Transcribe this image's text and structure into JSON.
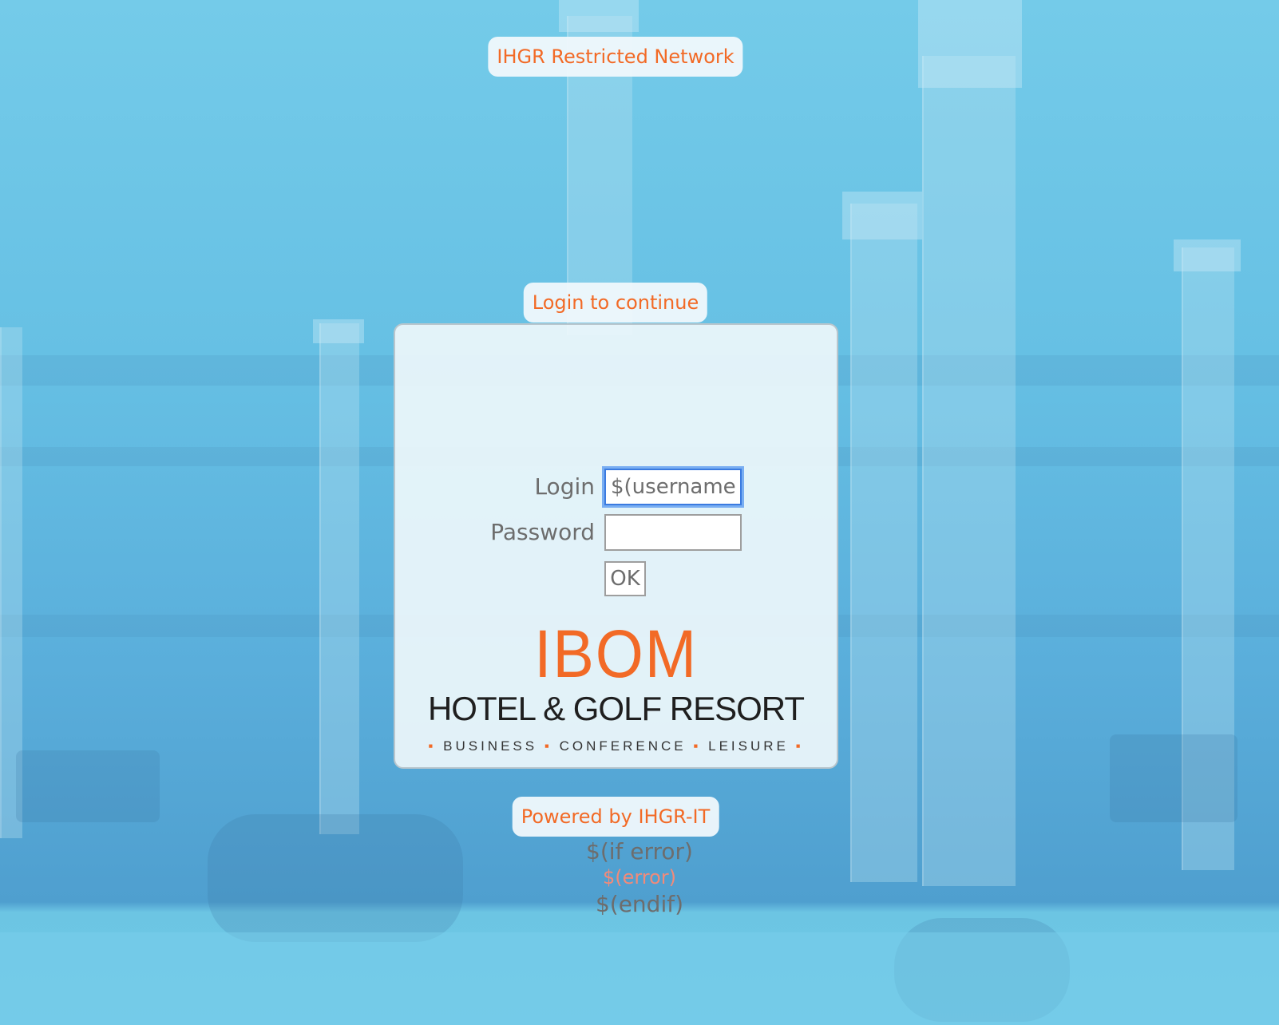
{
  "header": {
    "network_title": "IHGR Restricted Network"
  },
  "login_prompt": "Login to continue",
  "form": {
    "login_label": "Login",
    "login_value": "$(username)",
    "password_label": "Password",
    "password_value": "",
    "ok_label": "OK"
  },
  "logo": {
    "brand": "IBOM",
    "subtitle": "HOTEL & GOLF RESORT",
    "tagline_items": [
      "BUSINESS",
      "CONFERENCE",
      "LEISURE"
    ]
  },
  "footer": {
    "powered_by": "Powered by IHGR-IT",
    "if_error": "$(if error)",
    "error": "$(error)",
    "endif": "$(endif)"
  },
  "colors": {
    "accent": "#f26a26",
    "text": "#6d6d6d",
    "focus": "#3b7be0"
  }
}
